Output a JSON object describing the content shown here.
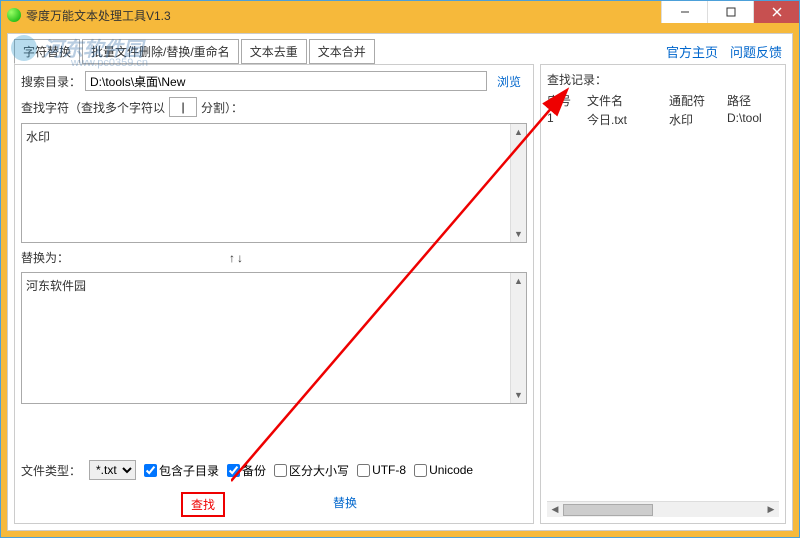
{
  "window": {
    "title": "零度万能文本处理工具V1.3"
  },
  "win_controls": {
    "minimize": "minimize",
    "maximize": "maximize",
    "close": "close"
  },
  "links": {
    "home": "官方主页",
    "feedback": "问题反馈"
  },
  "tabs": [
    "字符替换",
    "批量文件删除/替换/重命名",
    "文本去重",
    "文本合并"
  ],
  "left": {
    "search_dir_label": "搜索目录：",
    "search_dir_value": "D:\\tools\\桌面\\New",
    "browse": "浏览",
    "search_char_label_pre": "查找字符（查找多个字符以",
    "search_char_sep": "|",
    "search_char_label_post": "分割）：",
    "search_text": "水印",
    "replace_label": "替换为：",
    "swap": "↑↓",
    "replace_text": "河东软件园",
    "filetype_label": "文件类型：",
    "filetype_value": "*.txt",
    "chk_subdir": "包含子目录",
    "chk_backup": "备份",
    "chk_case": "区分大小写",
    "chk_utf8": "UTF-8",
    "chk_unicode": "Unicode",
    "btn_search": "查找",
    "btn_replace": "替换"
  },
  "right": {
    "title": "查找记录：",
    "headers": {
      "seq": "序号",
      "filename": "文件名",
      "wildcard": "通配符",
      "path": "路径"
    },
    "rows": [
      {
        "seq": "1",
        "filename": "今日.txt",
        "wildcard": "水印",
        "path": "D:\\tool"
      }
    ]
  },
  "watermark": {
    "main": "河东软件园",
    "sub": "www.pc0359.cn"
  }
}
